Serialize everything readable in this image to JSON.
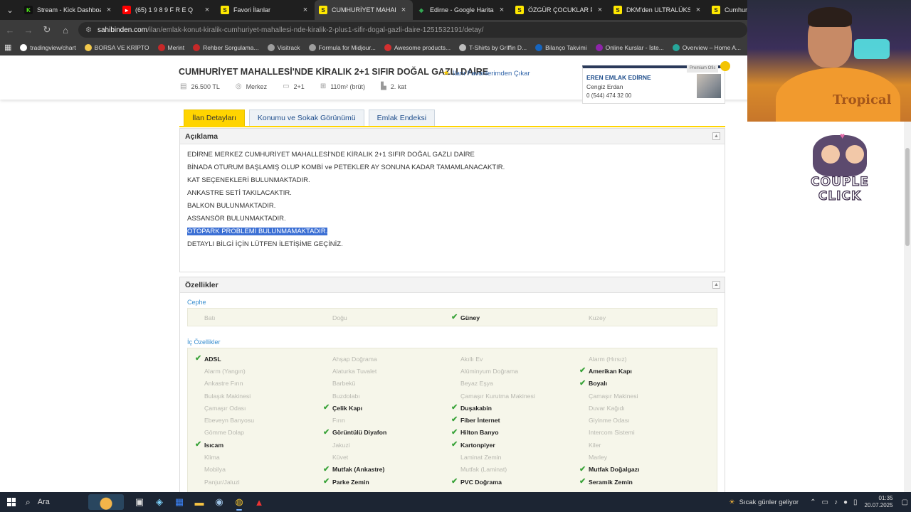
{
  "browser": {
    "tabs": [
      {
        "title": "Stream - Kick Dashboard",
        "favicon": "kick-icon",
        "active": false
      },
      {
        "title": "(65) 1 9 8 9   F R E Q",
        "favicon": "youtube-icon",
        "active": false
      },
      {
        "title": "Favori İlanlar",
        "favicon": "sahibinden-icon",
        "active": false
      },
      {
        "title": "CUMHURİYET MAHALLESİ",
        "favicon": "sahibinden-icon",
        "active": true
      },
      {
        "title": "Edirne - Google Haritalar",
        "favicon": "maps-icon",
        "active": false
      },
      {
        "title": "ÖZGÜR ÇOCUKLAR PARK",
        "favicon": "sahibinden-icon",
        "active": false
      },
      {
        "title": "DKM'den ULTRALÜKS PR",
        "favicon": "sahibinden-icon",
        "active": false
      },
      {
        "title": "Cumhuriy",
        "favicon": "sahibinden-icon",
        "active": false
      }
    ],
    "url_host": "sahibinden.com",
    "url_path": "/ilan/emlak-konut-kiralik-cumhuriyet-mahallesi-nde-kiralik-2-plus1-sifir-dogal-gazli-daire-1251532191/detay/",
    "bookmarks": [
      {
        "label": "tradingview/chart",
        "color": "#ffffff"
      },
      {
        "label": "BORSA VE KRİPTO",
        "color": "#f2c94c"
      },
      {
        "label": "Merint",
        "color": "#c62828"
      },
      {
        "label": "Rehber Sorgulama...",
        "color": "#c62828"
      },
      {
        "label": "Visitrack",
        "color": "#9e9e9e"
      },
      {
        "label": "Formula for Midjour...",
        "color": "#9e9e9e"
      },
      {
        "label": "Awesome products...",
        "color": "#d32f2f"
      },
      {
        "label": "T-Shirts by Griffin D...",
        "color": "#bdbdbd"
      },
      {
        "label": "Bilanço Takvimi",
        "color": "#1565c0"
      },
      {
        "label": "Online Kurslar - İste...",
        "color": "#8e24aa"
      },
      {
        "label": "Overview – Home A...",
        "color": "#26a69a"
      }
    ]
  },
  "listing": {
    "title": "CUMHURİYET MAHALLESİ'NDE KİRALIK 2+1 SIFIR DOĞAL GAZLI DAİRE",
    "favorite_link": "İlanı Favorilerimden Çıkar",
    "price": "26.500 TL",
    "location": "Merkez",
    "rooms": "2+1",
    "area": "110m² (brüt)",
    "floor": "2. kat"
  },
  "agent": {
    "premium": "Premium Ofis",
    "name": "EREN EMLAK EDİRNE",
    "person": "Cengiz Erdan",
    "phone": "0 (544) 474 32 00"
  },
  "tabs": [
    "İlan Detayları",
    "Konumu ve Sokak Görünümü",
    "Emlak Endeksi"
  ],
  "description": {
    "heading": "Açıklama",
    "lines": [
      "EDİRNE MERKEZ CUMHURİYET MAHALLESİ'NDE KİRALIK 2+1 SIFIR DOĞAL GAZLI DAİRE",
      "BİNADA OTURUM BAŞLAMIŞ OLUP KOMBİ ve PETEKLER AY SONUNA KADAR TAMAMLANACAKTIR.",
      "KAT SEÇENEKLERİ BULUNMAKTADIR.",
      "ANKASTRE SETİ TAKILACAKTIR.",
      "BALKON BULUNMAKTADIR.",
      "ASSANSÖR BULUNMAKTADIR.",
      "OTOPARK PROBLEMİ BULUNMAMAKTADIR.",
      "DETAYLI BİLGİ İÇİN LÜTFEN İLETİŞİME GEÇİNİZ."
    ],
    "selected_line": 6
  },
  "features": {
    "heading": "Özellikler",
    "cephe_title": "Cephe",
    "cephe": [
      {
        "label": "Batı",
        "on": false
      },
      {
        "label": "Doğu",
        "on": false
      },
      {
        "label": "Güney",
        "on": true
      },
      {
        "label": "Kuzey",
        "on": false
      }
    ],
    "ic_title": "İç Özellikler",
    "ic": [
      {
        "label": "ADSL",
        "on": true
      },
      {
        "label": "Ahşap Doğrama",
        "on": false
      },
      {
        "label": "Akıllı Ev",
        "on": false
      },
      {
        "label": "Alarm (Hırsız)",
        "on": false
      },
      {
        "label": "Alarm (Yangın)",
        "on": false
      },
      {
        "label": "Alaturka Tuvalet",
        "on": false
      },
      {
        "label": "Alüminyum Doğrama",
        "on": false
      },
      {
        "label": "Amerikan Kapı",
        "on": true
      },
      {
        "label": "Ankastre Fırın",
        "on": false
      },
      {
        "label": "Barbekü",
        "on": false
      },
      {
        "label": "Beyaz Eşya",
        "on": false
      },
      {
        "label": "Boyalı",
        "on": true
      },
      {
        "label": "Bulaşık Makinesi",
        "on": false
      },
      {
        "label": "Buzdolabı",
        "on": false
      },
      {
        "label": "Çamaşır Kurutma Makinesi",
        "on": false
      },
      {
        "label": "Çamaşır Makinesi",
        "on": false
      },
      {
        "label": "Çamaşır Odası",
        "on": false
      },
      {
        "label": "Çelik Kapı",
        "on": true
      },
      {
        "label": "Duşakabin",
        "on": true
      },
      {
        "label": "Duvar Kağıdı",
        "on": false
      },
      {
        "label": "Ebeveyn Banyosu",
        "on": false
      },
      {
        "label": "Fırın",
        "on": false
      },
      {
        "label": "Fiber İnternet",
        "on": true
      },
      {
        "label": "Giyinme Odası",
        "on": false
      },
      {
        "label": "Gömme Dolap",
        "on": false
      },
      {
        "label": "Görüntülü Diyafon",
        "on": true
      },
      {
        "label": "Hilton Banyo",
        "on": true
      },
      {
        "label": "Intercom Sistemi",
        "on": false
      },
      {
        "label": "Isıcam",
        "on": true
      },
      {
        "label": "Jakuzi",
        "on": false
      },
      {
        "label": "Kartonpiyer",
        "on": true
      },
      {
        "label": "Kiler",
        "on": false
      },
      {
        "label": "Klima",
        "on": false
      },
      {
        "label": "Küvet",
        "on": false
      },
      {
        "label": "Laminat Zemin",
        "on": false
      },
      {
        "label": "Marley",
        "on": false
      },
      {
        "label": "Mobilya",
        "on": false
      },
      {
        "label": "Mutfak (Ankastre)",
        "on": true
      },
      {
        "label": "Mutfak (Laminat)",
        "on": false
      },
      {
        "label": "Mutfak Doğalgazı",
        "on": true
      },
      {
        "label": "Panjur/Jaluzi",
        "on": false
      },
      {
        "label": "Parke Zemin",
        "on": true
      },
      {
        "label": "PVC Doğrama",
        "on": true
      },
      {
        "label": "Seramik Zemin",
        "on": true
      }
    ]
  },
  "overlay": {
    "logo_line1": "COUPLE",
    "logo_line2": "CLICK",
    "cam_text": "Tropical"
  },
  "taskbar": {
    "search": "Ara",
    "weather": "Sıcak günler geliyor",
    "time": "01:35",
    "date": "20.07.2025"
  }
}
